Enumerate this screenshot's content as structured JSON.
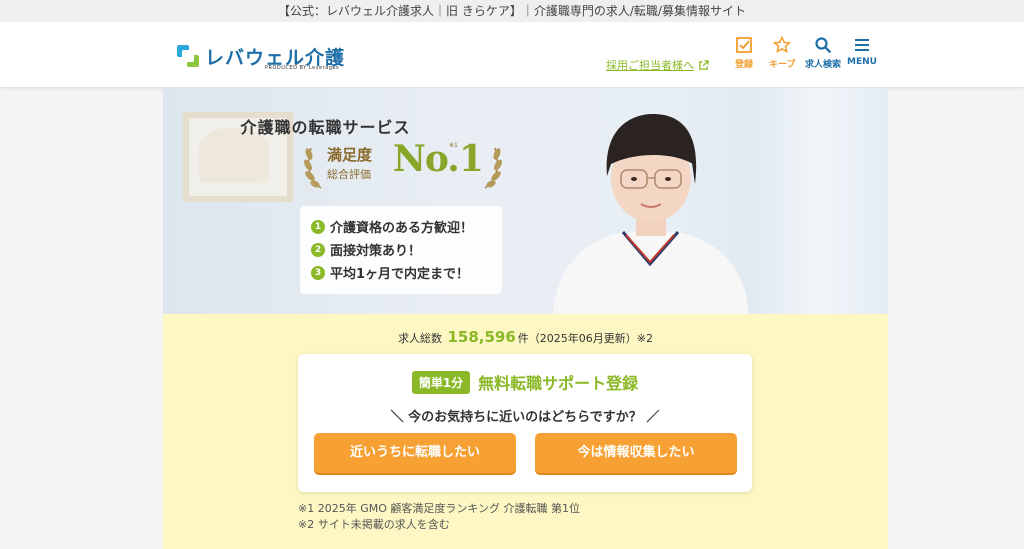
{
  "topbar": {
    "text": "【公式：レバウェル介護求人｜旧 きらケア】｜介護職専門の求人/転職/募集情報サイト"
  },
  "header": {
    "logo_text": "レバウェル",
    "logo_text2": "介護",
    "logo_sub": "PRODUCED BY Leverages",
    "recruit_link": "採用ご担当者様へ",
    "nav": [
      {
        "label": "登録",
        "icon": "checkbox-icon"
      },
      {
        "label": "キープ",
        "icon": "star-icon"
      },
      {
        "label": "求人検索",
        "icon": "search-icon"
      },
      {
        "label": "MENU",
        "icon": "menu-icon"
      }
    ]
  },
  "hero": {
    "catch": "介護職の転職サービス",
    "satisfaction": "満足度",
    "overall": "総合評価",
    "no1": "No.1",
    "no1_mark": "※1",
    "points": [
      {
        "num": "1",
        "text": "介護資格のある方歓迎！"
      },
      {
        "num": "2",
        "text": "面接対策あり！"
      },
      {
        "num": "3",
        "text": "平均1ヶ月で内定まで！"
      }
    ]
  },
  "signup": {
    "count_prefix": "求人総数",
    "count": "158,596",
    "count_suffix": "件（2025年06月更新）※2",
    "badge": "簡単1分",
    "title": "無料転職サポート登録",
    "question": "＼ 今のお気持ちに近いのはどちらですか？ ／",
    "btn_a": "近いうちに転職したい",
    "btn_b": "今は情報収集したい"
  },
  "notes": [
    "※1 2025年 GMO 顧客満足度ランキング 介護転職 第1位",
    "※2 サイト未掲載の求人を含む"
  ],
  "colors": {
    "brand_green": "#8ab826",
    "brand_blue": "#1e6fa8",
    "accent_orange": "#f7a135",
    "bg_yellow": "#fdf7c3"
  }
}
